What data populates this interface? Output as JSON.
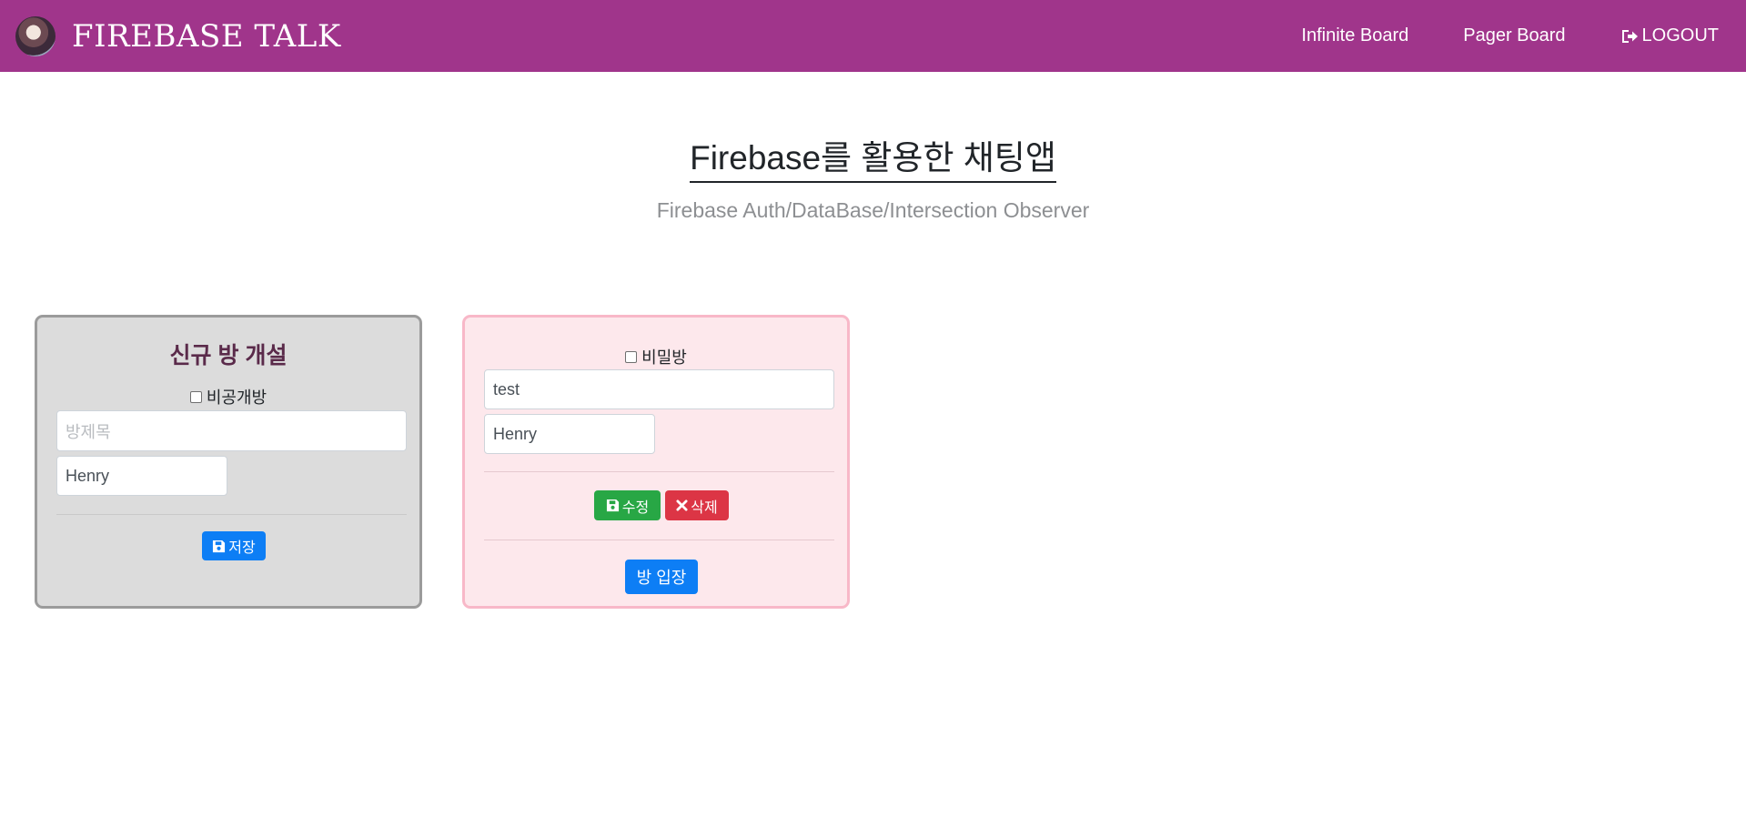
{
  "navbar": {
    "brand": "FIREBASE TALK",
    "links": {
      "infinite": "Infinite Board",
      "pager": "Pager Board",
      "logout": "LOGOUT"
    }
  },
  "header": {
    "title": "Firebase를 활용한 채팅앱",
    "subtitle": "Firebase Auth/DataBase/Intersection Observer"
  },
  "new_room": {
    "title": "신규 방 개설",
    "private_label": "비공개방",
    "private_checked": false,
    "title_placeholder": "방제목",
    "owner_value": "Henry",
    "save_label": "저장"
  },
  "room": {
    "secret_label": "비밀방",
    "secret_checked": false,
    "title_value": "test",
    "owner_value": "Henry",
    "edit_label": "수정",
    "delete_label": "삭제",
    "enter_label": "방 입장"
  },
  "colors": {
    "navbar": "#a0358b",
    "new_card_bg": "#dcdcdc",
    "room_card_bg": "#fde8ec",
    "primary": "#0d7ef5",
    "success": "#28a745",
    "danger": "#dc3545"
  },
  "icons": {
    "logout": "sign-out-icon",
    "save": "floppy-disk-icon",
    "delete": "x-mark-icon"
  }
}
